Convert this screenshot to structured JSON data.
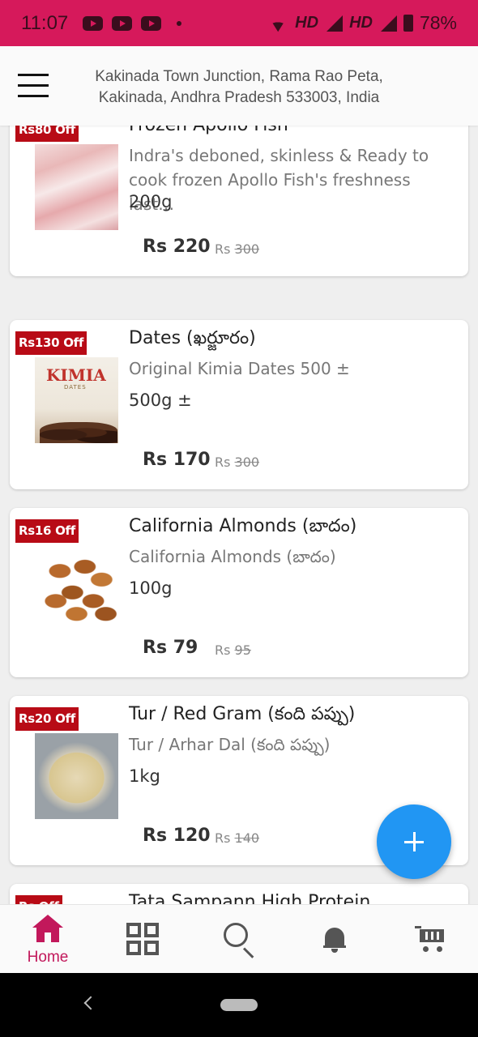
{
  "status_bar": {
    "time": "11:07",
    "network_1": "HD",
    "network_2": "HD",
    "battery": "78%"
  },
  "header": {
    "address_line_1": "Kakinada Town Junction, Rama Rao Peta,",
    "address_line_2": "Kakinada, Andhra Pradesh 533003, India"
  },
  "products": [
    {
      "badge": "Rs80 Off",
      "name": "Frozen Apollo Fish",
      "description": "Indra's deboned, skinless & Ready to cook frozen Apollo Fish's freshness last…",
      "quantity": "200g",
      "price": "Rs 220",
      "mrp_prefix": "Rs",
      "mrp": "300",
      "image": "fish-image"
    },
    {
      "badge": "Rs130 Off",
      "name": "Dates (ఖర్జూరం)",
      "description": "Original Kimia Dates 500  ±",
      "quantity": "500g  ±",
      "price": "Rs 170",
      "mrp_prefix": "Rs",
      "mrp": "300",
      "image_text": "KIMIA",
      "image_subtext": "DATES",
      "image": "dates-image"
    },
    {
      "badge": "Rs16 Off",
      "name": "California Almonds (బాదం)",
      "description": "California Almonds (బాదం)",
      "quantity": "100g",
      "price": "Rs 79",
      "mrp_prefix": "Rs",
      "mrp": "95",
      "image": "almonds-image"
    },
    {
      "badge": "Rs20 Off",
      "name": "Tur / Red Gram (కంది పప్పు)",
      "description": "Tur / Arhar Dal (కంది పప్పు)",
      "quantity": "1kg",
      "price": "Rs 120",
      "mrp_prefix": "Rs",
      "mrp": "140",
      "image": "dal-image"
    },
    {
      "badge": "Rs Off",
      "name": "Tata Sampann High Protein",
      "description": "",
      "quantity": "",
      "price": "",
      "mrp_prefix": "",
      "mrp": "",
      "image": "partial-image"
    }
  ],
  "bottom_nav": {
    "home_label": "Home",
    "items": [
      "home-icon",
      "qr-icon",
      "search-icon",
      "bell-icon",
      "cart-icon"
    ]
  },
  "colors": {
    "status_bar": "#d6195b",
    "accent": "#c2185b",
    "badge": "#b80b16",
    "fab": "#2196f3"
  }
}
